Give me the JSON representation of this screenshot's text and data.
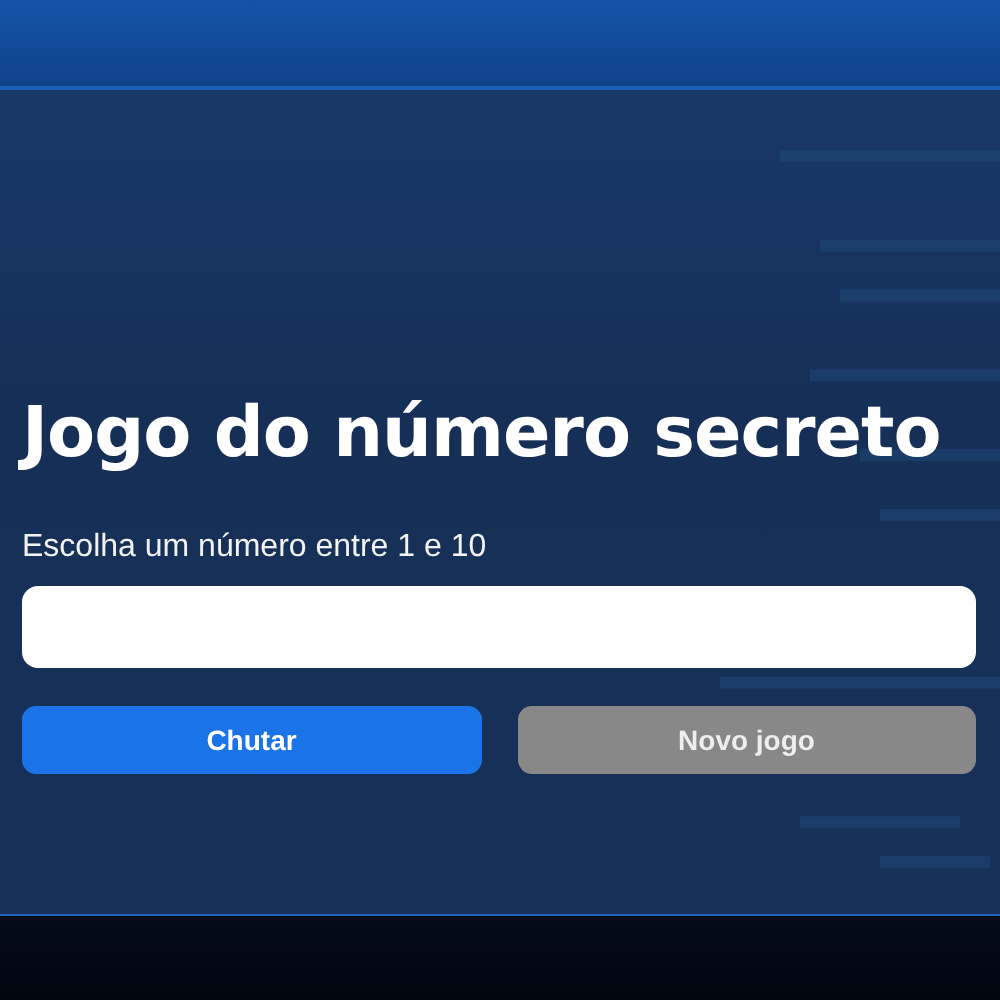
{
  "title": "Jogo do número secreto",
  "prompt": "Escolha um número entre 1 e 10",
  "buttons": [
    {
      "label": "Chutar",
      "disabled": false
    },
    {
      "label": "Novo jogo",
      "disabled": true
    }
  ]
}
